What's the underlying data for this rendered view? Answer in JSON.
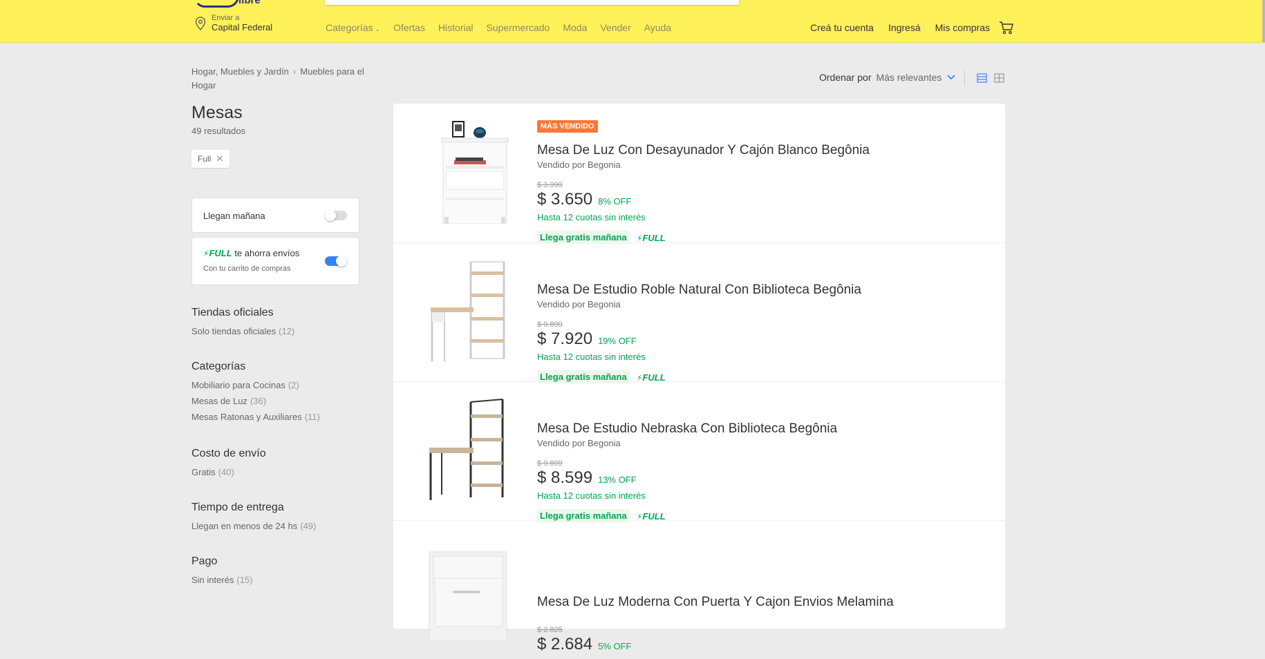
{
  "header": {
    "logo_text": "libre",
    "location_label": "Enviar a",
    "location_value": "Capital Federal",
    "nav": [
      "Categorías",
      "Ofertas",
      "Historial",
      "Supermercado",
      "Moda",
      "Vender",
      "Ayuda"
    ],
    "user_nav": [
      "Creá tu cuenta",
      "Ingresá",
      "Mis compras"
    ],
    "colors": {
      "bar": "#fff159",
      "text": "#333333"
    }
  },
  "breadcrumb": [
    "Hogar, Muebles y Jardín",
    "Muebles para el Hogar"
  ],
  "page_title": "Mesas",
  "results_count": "49 resultados",
  "applied_filter": "Full",
  "filters_cards": {
    "tomorrow": {
      "label": "Llegan mañana",
      "enabled": false
    },
    "full": {
      "full_word": "FULL",
      "label": "te ahorra envíos",
      "sub": "Con tu carrito de compras",
      "enabled": true
    }
  },
  "filter_sections": [
    {
      "heading": "Tiendas oficiales",
      "items": [
        {
          "label": "Solo tiendas oficiales",
          "count": "(12)"
        }
      ]
    },
    {
      "heading": "Categorías",
      "items": [
        {
          "label": "Mobiliario para Cocinas",
          "count": "(2)"
        },
        {
          "label": "Mesas de Luz",
          "count": "(36)"
        },
        {
          "label": "Mesas Ratonas y Auxiliares",
          "count": "(11)"
        }
      ]
    },
    {
      "heading": "Costo de envío",
      "items": [
        {
          "label": "Gratis",
          "count": "(40)"
        }
      ]
    },
    {
      "heading": "Tiempo de entrega",
      "items": [
        {
          "label": "Llegan en menos de 24 hs",
          "count": "(49)"
        }
      ]
    },
    {
      "heading": "Pago",
      "items": [
        {
          "label": "Sin interés",
          "count": "(15)"
        }
      ]
    }
  ],
  "sort": {
    "label": "Ordenar por",
    "value": "Más relevantes"
  },
  "items": [
    {
      "badge": "MÁS VENDIDO",
      "title": "Mesa De Luz Con Desayunador Y Cajón Blanco Begônia",
      "seller": "Vendido por Begonia",
      "old_price": "$ 3.999",
      "price": "$ 3.650",
      "off": "8% OFF",
      "installments": "Hasta 12 cuotas sin interés",
      "shipping": "Llega gratis mañana",
      "full": "FULL"
    },
    {
      "badge": "",
      "title": "Mesa De Estudio Roble Natural Con Biblioteca Begônia",
      "seller": "Vendido por Begonia",
      "old_price": "$ 9.899",
      "price": "$ 7.920",
      "off": "19% OFF",
      "installments": "Hasta 12 cuotas sin interés",
      "shipping": "Llega gratis mañana",
      "full": "FULL"
    },
    {
      "badge": "",
      "title": "Mesa De Estudio Nebraska Con Biblioteca Begônia",
      "seller": "Vendido por Begonia",
      "old_price": "$ 9.899",
      "price": "$ 8.599",
      "off": "13% OFF",
      "installments": "Hasta 12 cuotas sin interés",
      "shipping": "Llega gratis mañana",
      "full": "FULL"
    },
    {
      "badge": "",
      "title": "Mesa De Luz Moderna Con Puerta Y Cajon Envios Melamina",
      "seller": "",
      "old_price": "$ 2.825",
      "price": "$ 2.684",
      "off": "5% OFF",
      "installments": "",
      "shipping": "",
      "full": ""
    }
  ]
}
